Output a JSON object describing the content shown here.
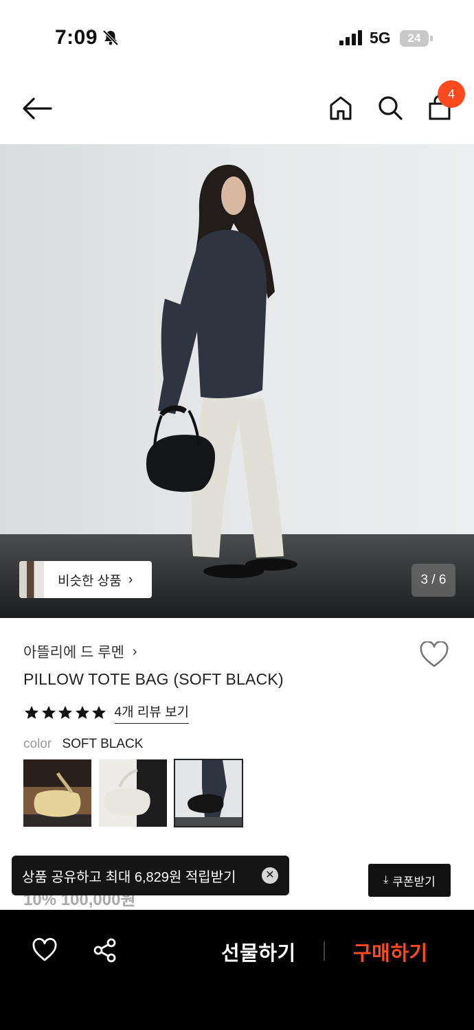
{
  "status_bar": {
    "time": "7:09",
    "network": "5G",
    "battery": "24"
  },
  "nav": {
    "cart_count": "4"
  },
  "gallery": {
    "similar_label": "비슷한 상품",
    "pager": "3 / 6"
  },
  "product": {
    "brand": "아뜰리에 드 루멘",
    "name": "PILLOW TOTE BAG (SOFT BLACK)",
    "rating_stars": 5,
    "review_link": "4개 리뷰 보기",
    "color_key": "color",
    "color_value": "SOFT BLACK",
    "swatches": [
      "butter",
      "ivory",
      "soft-black"
    ]
  },
  "toast": {
    "text": "상품 공유하고 최대 6,829원 적립받기"
  },
  "price_partial": "10% 100,000원",
  "coupon": {
    "label": "쿠폰받기"
  },
  "bottom_bar": {
    "gift": "선물하기",
    "buy": "구매하기"
  },
  "colors": {
    "accent": "#ff4a1f",
    "bar_bg": "#000000"
  },
  "icons": [
    "back-arrow-icon",
    "home-icon",
    "search-icon",
    "shopping-bag-icon",
    "heart-icon",
    "share-icon",
    "download-icon",
    "close-icon",
    "star-icon",
    "chevron-right-icon",
    "bell-slash-icon",
    "signal-icon",
    "battery-icon"
  ]
}
